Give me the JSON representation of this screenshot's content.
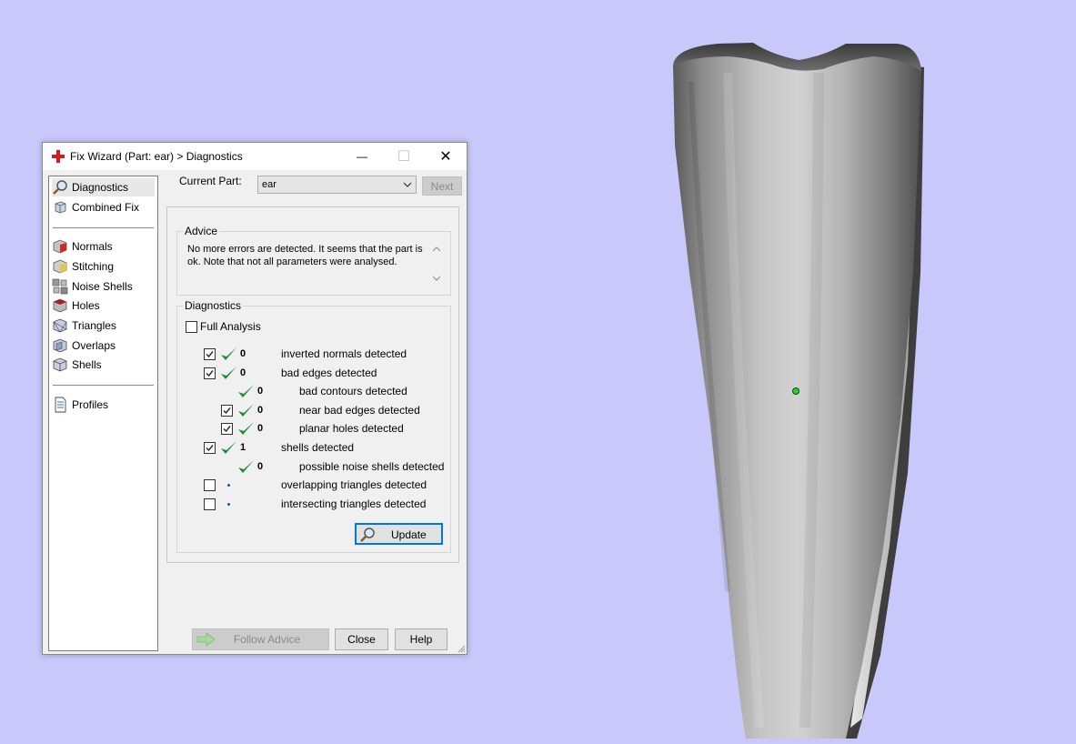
{
  "window": {
    "title": "Fix Wizard (Part: ear) > Diagnostics",
    "minimize_glyph": "—",
    "maximize_glyph": "☐",
    "close_glyph": "✕"
  },
  "sidebar": {
    "items": [
      {
        "label": "Diagnostics",
        "icon": "magnifier-icon"
      },
      {
        "label": "Combined Fix",
        "icon": "cube-icon"
      },
      {
        "label": "Normals",
        "icon": "normals-cube-icon"
      },
      {
        "label": "Stitching",
        "icon": "stitching-cube-icon"
      },
      {
        "label": "Noise Shells",
        "icon": "noise-shells-icon"
      },
      {
        "label": "Holes",
        "icon": "holes-cube-icon"
      },
      {
        "label": "Triangles",
        "icon": "triangles-cube-icon"
      },
      {
        "label": "Overlaps",
        "icon": "overlaps-cube-icon"
      },
      {
        "label": "Shells",
        "icon": "shells-cube-icon"
      },
      {
        "label": "Profiles",
        "icon": "profile-document-icon"
      }
    ]
  },
  "header": {
    "current_part_label": "Current Part:",
    "current_part_value": "ear",
    "next_label": "Next"
  },
  "advice": {
    "title": "Advice",
    "text": "No more errors are detected. It seems that the part is ok. Note that not all parameters were analysed."
  },
  "diagnostics": {
    "title": "Diagnostics",
    "full_analysis_label": "Full Analysis",
    "full_analysis_checked": false,
    "rows": [
      {
        "checked": true,
        "has_checkbox": true,
        "status": "ok",
        "count": "0",
        "label": "inverted normals detected",
        "indent": 0
      },
      {
        "checked": true,
        "has_checkbox": true,
        "status": "ok",
        "count": "0",
        "label": "bad edges detected",
        "indent": 0
      },
      {
        "checked": false,
        "has_checkbox": false,
        "status": "ok",
        "count": "0",
        "label": "bad contours detected",
        "indent": 1
      },
      {
        "checked": true,
        "has_checkbox": true,
        "status": "ok",
        "count": "0",
        "label": "near bad edges detected",
        "indent": 1
      },
      {
        "checked": true,
        "has_checkbox": true,
        "status": "ok",
        "count": "0",
        "label": "planar holes detected",
        "indent": 1
      },
      {
        "checked": true,
        "has_checkbox": true,
        "status": "ok",
        "count": "1",
        "label": "shells detected",
        "indent": 0
      },
      {
        "checked": false,
        "has_checkbox": false,
        "status": "ok",
        "count": "0",
        "label": "possible noise shells detected",
        "indent": 1
      },
      {
        "checked": false,
        "has_checkbox": true,
        "status": "pending",
        "count": "",
        "label": "overlapping triangles detected",
        "indent": 0
      },
      {
        "checked": false,
        "has_checkbox": true,
        "status": "pending",
        "count": "",
        "label": "intersecting triangles detected",
        "indent": 0
      }
    ],
    "update_label": "Update"
  },
  "footer": {
    "follow_advice_label": "Follow Advice",
    "close_label": "Close",
    "help_label": "Help"
  },
  "colors": {
    "background": "#c8c8fa",
    "check_green": "#1e8c3a",
    "focus_blue": "#0078d7"
  }
}
